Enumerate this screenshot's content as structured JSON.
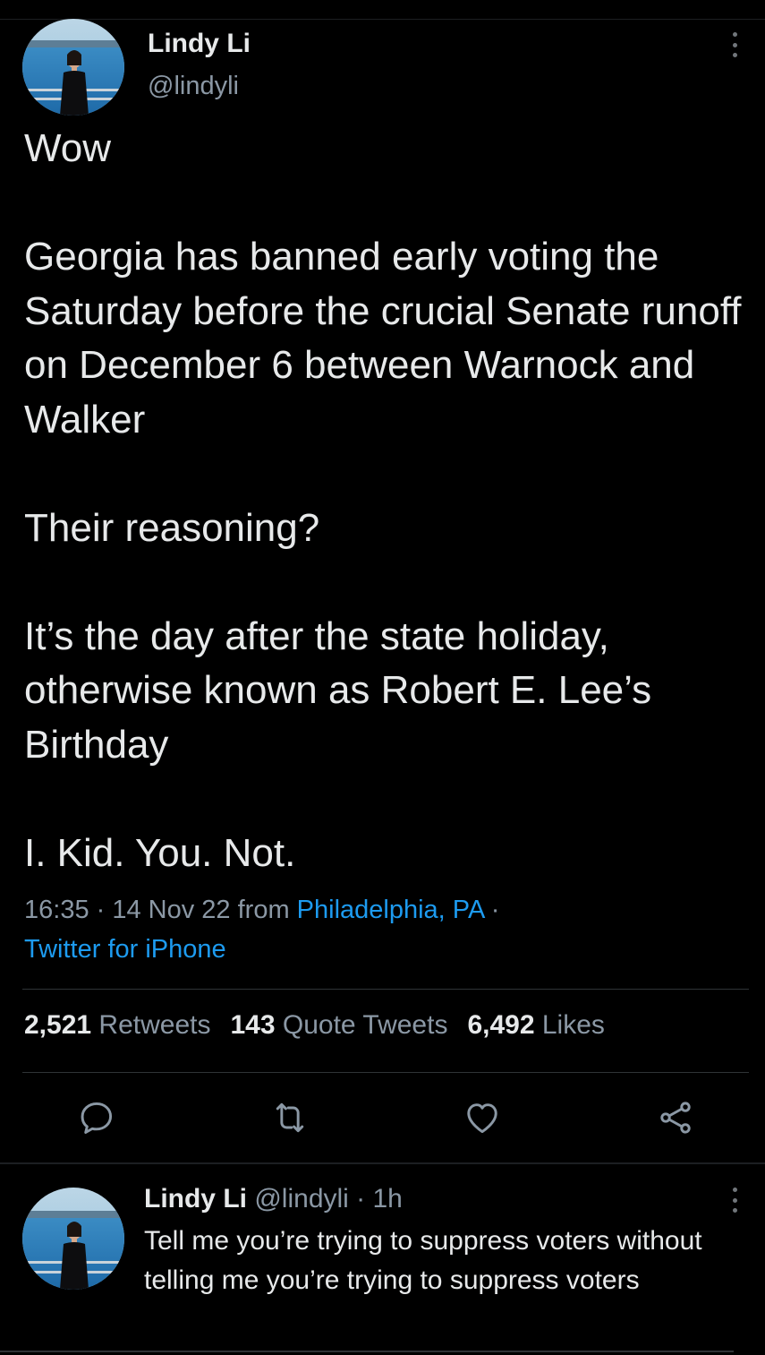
{
  "tweet": {
    "author_name": "Lindy Li",
    "author_handle": "@lindyli",
    "text": "Wow\n\nGeorgia has banned early voting the Saturday before the crucial Senate runoff on December 6 between Warnock and Walker\n\nTheir reasoning?\n\nIt’s the day after the state holiday, otherwise known as Robert E. Lee’s Birthday\n\nI. Kid. You. Not.",
    "timestamp": "16:35 · 14 Nov 22 from",
    "location": "Philadelphia, PA",
    "separator": " ·",
    "client": "Twitter for iPhone"
  },
  "stats": {
    "retweets_count": "2,521",
    "retweets_label": "Retweets",
    "quotes_count": "143",
    "quotes_label": "Quote Tweets",
    "likes_count": "6,492",
    "likes_label": "Likes"
  },
  "actions": {
    "reply_icon": "reply-icon",
    "retweet_icon": "retweet-icon",
    "like_icon": "heart-icon",
    "share_icon": "share-icon"
  },
  "reply": {
    "author_name": "Lindy Li",
    "author_handle": "@lindyli",
    "time": "· 1h",
    "text": "Tell me you’re trying to suppress voters without telling me you’re trying to suppress voters"
  },
  "colors": {
    "background": "#000000",
    "text": "#e7e9ea",
    "secondary_text": "#8b98a5",
    "link": "#1d9bf0"
  }
}
